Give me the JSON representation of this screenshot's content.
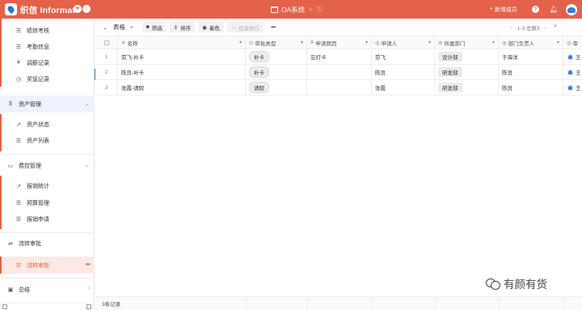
{
  "app": {
    "brand": "织信 Informat",
    "center_title": "OA系统",
    "new_member": "新增成员"
  },
  "sidebar": {
    "items": [
      {
        "label": "绩效考核",
        "icon": "list-icon",
        "level": "sub"
      },
      {
        "label": "考勤信息",
        "icon": "list-icon",
        "level": "sub"
      },
      {
        "label": "调薪记录",
        "icon": "yen-icon",
        "level": "sub"
      },
      {
        "label": "奖惩记录",
        "icon": "clock-icon",
        "level": "sub"
      },
      {
        "label": "资产管理",
        "icon": "dollar-icon",
        "level": "group",
        "state": "active-group"
      },
      {
        "label": "资产状态",
        "icon": "chart-icon",
        "level": "sub"
      },
      {
        "label": "资产列表",
        "icon": "list-icon",
        "level": "sub"
      },
      {
        "label": "费控管理",
        "icon": "wallet-icon",
        "level": "group"
      },
      {
        "label": "报销统计",
        "icon": "chart-icon",
        "level": "sub"
      },
      {
        "label": "预算管理",
        "icon": "list-icon",
        "level": "sub"
      },
      {
        "label": "报销申请",
        "icon": "list-icon",
        "level": "sub"
      },
      {
        "label": "流转审批",
        "icon": "flow-icon",
        "level": "group"
      },
      {
        "label": "流转审批",
        "icon": "list-icon",
        "level": "sub",
        "state": "active"
      },
      {
        "label": "总结",
        "icon": "note-icon",
        "level": "group"
      }
    ]
  },
  "toolbar": {
    "title": "表格",
    "filter_label": "筛选",
    "sort_label": "排序",
    "color_label": "着色",
    "batch_label": "批量操作",
    "pager_text": "1-3 总数3"
  },
  "table": {
    "columns": [
      {
        "label": "名称",
        "icon": "✳"
      },
      {
        "label": "审批类型",
        "icon": "⊙"
      },
      {
        "label": "申请原因",
        "icon": "A"
      },
      {
        "label": "申请人",
        "icon": "◎"
      },
      {
        "label": "所属部门",
        "icon": "⊘"
      },
      {
        "label": "部门负责人",
        "icon": "◎"
      },
      {
        "label": "审",
        "icon": "◎"
      }
    ],
    "rows": [
      {
        "idx": "1",
        "name": "劳飞-补卡",
        "type": "补卡",
        "reason": "忘打卡",
        "applicant": "劳飞",
        "dept": "设计部",
        "manager": "于海洋",
        "approver": "王"
      },
      {
        "idx": "2",
        "name": "陈良-补卡",
        "type": "补卡",
        "reason": "",
        "applicant": "陈良",
        "dept": "研发部",
        "manager": "陈良",
        "approver": "王"
      },
      {
        "idx": "3",
        "name": "张霞-请假",
        "type": "请假",
        "reason": "",
        "applicant": "张霞",
        "dept": "研发部",
        "manager": "陈良",
        "approver": "王"
      }
    ],
    "footer_count": "3条记录"
  },
  "watermark": {
    "text": "有颜有货"
  },
  "colors": {
    "brand": "#e4614a",
    "accent": "#3b7dd8"
  }
}
